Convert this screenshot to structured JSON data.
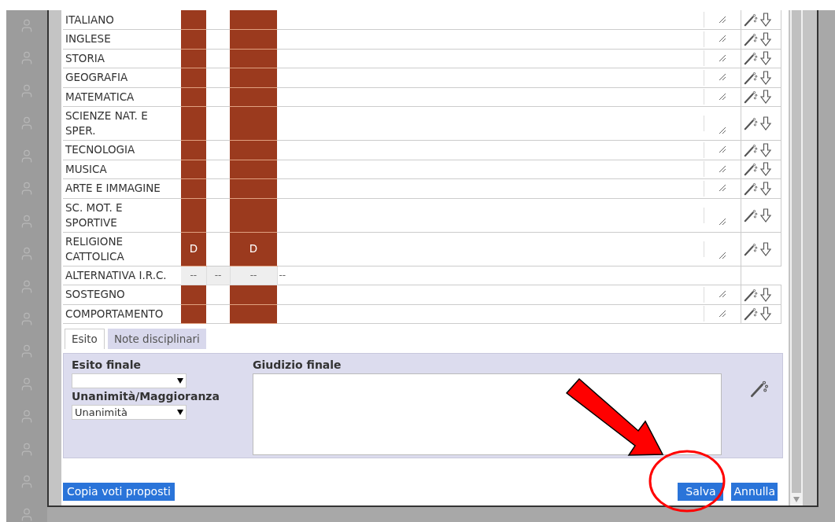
{
  "rows": [
    {
      "kind": "grade",
      "subject": "ITALIANO"
    },
    {
      "kind": "grade",
      "subject": "INGLESE"
    },
    {
      "kind": "grade",
      "subject": "STORIA"
    },
    {
      "kind": "grade",
      "subject": "GEOGRAFIA"
    },
    {
      "kind": "grade",
      "subject": "MATEMATICA"
    },
    {
      "kind": "grade",
      "subject": "SCIENZE NAT. E SPER."
    },
    {
      "kind": "grade",
      "subject": "TECNOLOGIA"
    },
    {
      "kind": "grade",
      "subject": "MUSICA"
    },
    {
      "kind": "grade",
      "subject": "ARTE E IMMAGINE"
    },
    {
      "kind": "grade",
      "subject": "SC. MOT. E SPORTIVE"
    },
    {
      "kind": "grade",
      "subject": "RELIGIONE CATTOLICA",
      "grade_1": "D",
      "grade_2": "D"
    },
    {
      "kind": "na",
      "subject": "ALTERNATIVA I.R.C.",
      "cells": [
        "--",
        "--",
        "--",
        "--"
      ]
    },
    {
      "kind": "grade",
      "subject": "SOSTEGNO"
    },
    {
      "kind": "grade",
      "subject": "COMPORTAMENTO"
    }
  ],
  "tabs": [
    {
      "label": "Esito",
      "selected": true
    },
    {
      "label": "Note disciplinari",
      "selected": false
    }
  ],
  "esito": {
    "label": "Esito finale"
  },
  "majority": {
    "label": "Unanimità/Maggioranza",
    "value": "Unanimità"
  },
  "judgement": {
    "label": "Giudizio finale"
  },
  "buttons": {
    "copy": "Copia voti proposti",
    "save": "Salva",
    "cancel": "Annulla"
  }
}
